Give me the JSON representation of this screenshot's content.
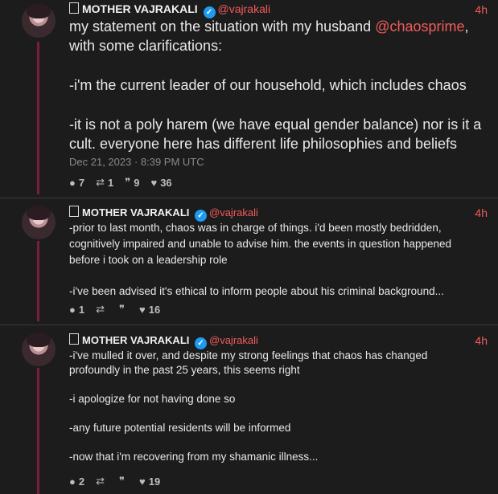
{
  "posts": [
    {
      "author": "MOTHER VAJRAKALI",
      "handle": "@vajrakali",
      "time": "4h",
      "lines": [
        {
          "pre": "my statement on the situation with my husband ",
          "mention": "@chaosprime",
          "post": ","
        },
        {
          "pre": "with some clarifications:",
          "mention": "",
          "post": ""
        },
        {
          "pre": "",
          "mention": "",
          "post": ""
        },
        {
          "pre": "-i'm the current leader of our household, which includes chaos",
          "mention": "",
          "post": ""
        },
        {
          "pre": "",
          "mention": "",
          "post": ""
        },
        {
          "pre": "-it is not a poly harem (we have equal gender balance) nor is it a",
          "mention": "",
          "post": ""
        },
        {
          "pre": "cult. everyone here has different life philosophies and beliefs",
          "mention": "",
          "post": ""
        }
      ],
      "date": "Dec 21, 2023 · 8:39 PM UTC",
      "replies": "7",
      "reposts": "1",
      "quotes": "9",
      "likes": "36"
    },
    {
      "author": "MOTHER VAJRAKALI",
      "handle": "@vajrakali",
      "time": "4h",
      "lines": [
        "-prior to last month, chaos was in charge of things. i'd been mostly bedridden,",
        "cognitively impaired and unable to advise him. the events in question happened",
        "before i took on a leadership role",
        "",
        "-i've been advised it's ethical to inform people about his criminal background..."
      ],
      "replies": "1",
      "reposts": "",
      "quotes": "",
      "likes": "16"
    },
    {
      "author": "MOTHER VAJRAKALI",
      "handle": "@vajrakali",
      "time": "4h",
      "lines": [
        "-i've mulled it over, and despite my strong feelings that chaos has changed",
        "profoundly in the past 25 years, this seems right",
        "",
        "-i apologize for not having done so",
        "",
        "-any future potential residents will be informed",
        "",
        "-now that i'm recovering from my shamanic illness..."
      ],
      "replies": "2",
      "reposts": "",
      "quotes": "",
      "likes": "19"
    }
  ],
  "icons": {
    "reply": "comment-icon",
    "repost": "repost-icon",
    "quote": "quote-icon",
    "like": "heart-icon"
  }
}
